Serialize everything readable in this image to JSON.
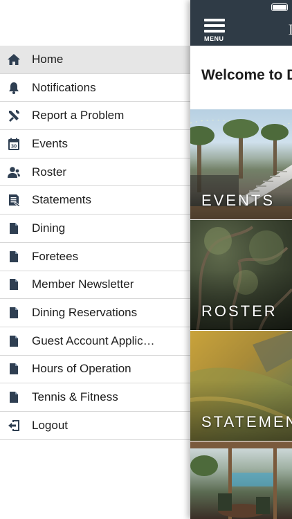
{
  "menu": {
    "items": [
      {
        "label": "Home",
        "icon": "home-icon",
        "active": true
      },
      {
        "label": "Notifications",
        "icon": "bell-icon"
      },
      {
        "label": "Report a Problem",
        "icon": "tools-icon"
      },
      {
        "label": "Events",
        "icon": "calendar-icon"
      },
      {
        "label": "Roster",
        "icon": "people-icon"
      },
      {
        "label": "Statements",
        "icon": "statement-icon"
      },
      {
        "label": "Dining",
        "icon": "document-icon"
      },
      {
        "label": "Foretees",
        "icon": "document-icon"
      },
      {
        "label": "Member Newsletter",
        "icon": "document-icon"
      },
      {
        "label": "Dining Reservations",
        "icon": "document-icon"
      },
      {
        "label": "Guest Account Applic…",
        "icon": "document-icon"
      },
      {
        "label": "Hours of Operation",
        "icon": "document-icon"
      },
      {
        "label": "Tennis & Fitness",
        "icon": "document-icon"
      },
      {
        "label": "Logout",
        "icon": "logout-icon"
      }
    ],
    "calendar_day": "30"
  },
  "topbar": {
    "menu_label": "MENU",
    "logo_letter": "I"
  },
  "main": {
    "welcome": "Welcome to D",
    "tiles": [
      {
        "label": "EVENTS"
      },
      {
        "label": "ROSTER"
      },
      {
        "label": "STATEMEN"
      },
      {
        "label": ""
      }
    ]
  },
  "colors": {
    "topbar": "#2f3b46",
    "icon": "#2f3f52",
    "active_row": "#e6e6e6"
  }
}
